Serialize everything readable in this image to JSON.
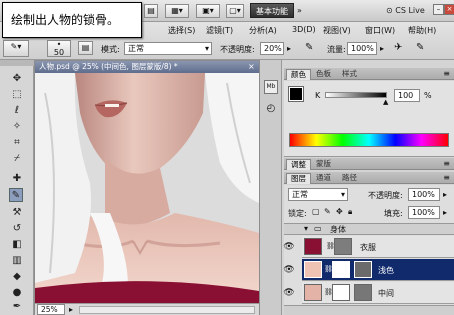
{
  "callout": {
    "text": "绘制出人物的锁骨。"
  },
  "menubar": {
    "items": [
      "选择(S)",
      "滤镜(T)",
      "分析(A)",
      "3D(D)",
      "视图(V)",
      "窗口(W)",
      "帮助(H)"
    ],
    "workspace_button": "基本功能",
    "live_button": "CS Live"
  },
  "options": {
    "brush_size": "50",
    "mode_label": "模式:",
    "mode_value": "正常",
    "opacity_label": "不透明度:",
    "opacity_value": "20%",
    "flow_label": "流量:",
    "flow_value": "100%"
  },
  "document": {
    "tab_title": "人物.psd @ 25% (中间色, 图层蒙版/8) *",
    "zoom": "25%"
  },
  "color_panel": {
    "tabs": [
      "颜色",
      "色板",
      "样式"
    ],
    "channel_label": "K",
    "k_value": "100",
    "k_unit": "%"
  },
  "adjust_panel": {
    "tabs": [
      "调整",
      "蒙版"
    ]
  },
  "layers_panel": {
    "tabs": [
      "图层",
      "通道",
      "路径"
    ],
    "blend_mode": "正常",
    "opacity_label": "不透明度:",
    "opacity_value": "100%",
    "lock_label": "锁定:",
    "fill_label": "填充:",
    "fill_value": "100%",
    "group_name": "身体",
    "layers": [
      {
        "name": "衣服"
      },
      {
        "name": "浅色"
      },
      {
        "name": "中间"
      }
    ]
  },
  "colors": {
    "accent_selected": "#102a6b",
    "clothes_swatch": "#8a1033",
    "skin_swatch": "#efc3b4",
    "foreground": "#000000",
    "background": "#ffffff"
  }
}
